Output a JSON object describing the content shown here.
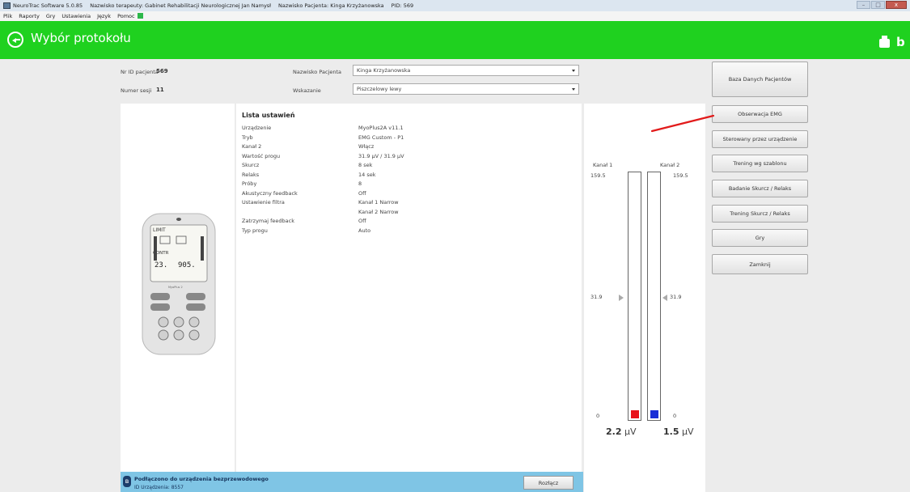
{
  "window": {
    "title_segments": [
      "NeuroTrac Software 5.0.85",
      "Nazwisko terapeuty: Gabinet Rehabilitacji Neurologicznej Jan Namysł",
      "Nazwisko Pacjenta: Kinga Krzyżanowska",
      "PID: 569"
    ]
  },
  "menu": {
    "items": [
      "Plik",
      "Raporty",
      "Gry",
      "Ustawienia",
      "Język",
      "Pomoc"
    ]
  },
  "header": {
    "title": "Wybór protokołu",
    "accent_color": "#1fd11f"
  },
  "patient": {
    "id_label": "Nr ID pacjenta",
    "id_value": "569",
    "session_label": "Numer sesji",
    "session_value": "11",
    "name_label": "Nazwisko Pacjenta",
    "name_value": "Kinga Krzyżanowska",
    "indication_label": "Wskazanie",
    "indication_value": "Piszczelowy lewy"
  },
  "settings": {
    "title": "Lista ustawień",
    "rows": [
      {
        "label": "Urządzenie",
        "value": "MyoPlus2A v11.1"
      },
      {
        "label": "Tryb",
        "value": "EMG Custom - P1"
      },
      {
        "label": "Kanał 2",
        "value": "Włącz"
      },
      {
        "label": "Wartość progu",
        "value": "31.9 µV / 31.9 µV"
      },
      {
        "label": "Skurcz",
        "value": "8 sek"
      },
      {
        "label": "Relaks",
        "value": "14 sek"
      },
      {
        "label": "Próby",
        "value": "8"
      },
      {
        "label": "Akustyczny feedback",
        "value": "Off"
      },
      {
        "label": "Ustawienie filtra",
        "value": "Kanał 1 Narrow"
      },
      {
        "label": "",
        "value": "Kanał 2 Narrow"
      },
      {
        "label": "Zatrzymaj feedback",
        "value": "Off"
      },
      {
        "label": "Typ progu",
        "value": "Auto"
      }
    ]
  },
  "device": {
    "lcd_top": "LIMIT",
    "lcd_mid": "CONTR",
    "lcd_num_left": "23.",
    "lcd_num_right": "905.",
    "brand": "MyoPlus 2"
  },
  "channels": {
    "ch1": {
      "label": "Kanał 1",
      "max": "159.5",
      "threshold": "31.9",
      "min": "0",
      "value": "2.2",
      "fraction": 0.014,
      "color": "#e8121b"
    },
    "ch2": {
      "label": "Kanał 2",
      "max": "159.5",
      "threshold": "31.9",
      "min": "0",
      "value": "1.5",
      "fraction": 0.009,
      "color": "#1a2fd6"
    },
    "unit": "µV"
  },
  "buttons": [
    "Baza Danych Pacjentów",
    "Obserwacja EMG",
    "Sterowany przez urządzenie",
    "Trening wg szablonu",
    "Badanie Skurcz / Relaks",
    "Trening Skurcz / Relaks",
    "Gry",
    "Zamknij"
  ],
  "status": {
    "line1": "Podłączono do urządzenia bezprzewodowego",
    "line2": "ID Urządzenia: 8557",
    "disconnect_label": "Rozłącz"
  },
  "annotation": {
    "color": "#e21b1b"
  }
}
